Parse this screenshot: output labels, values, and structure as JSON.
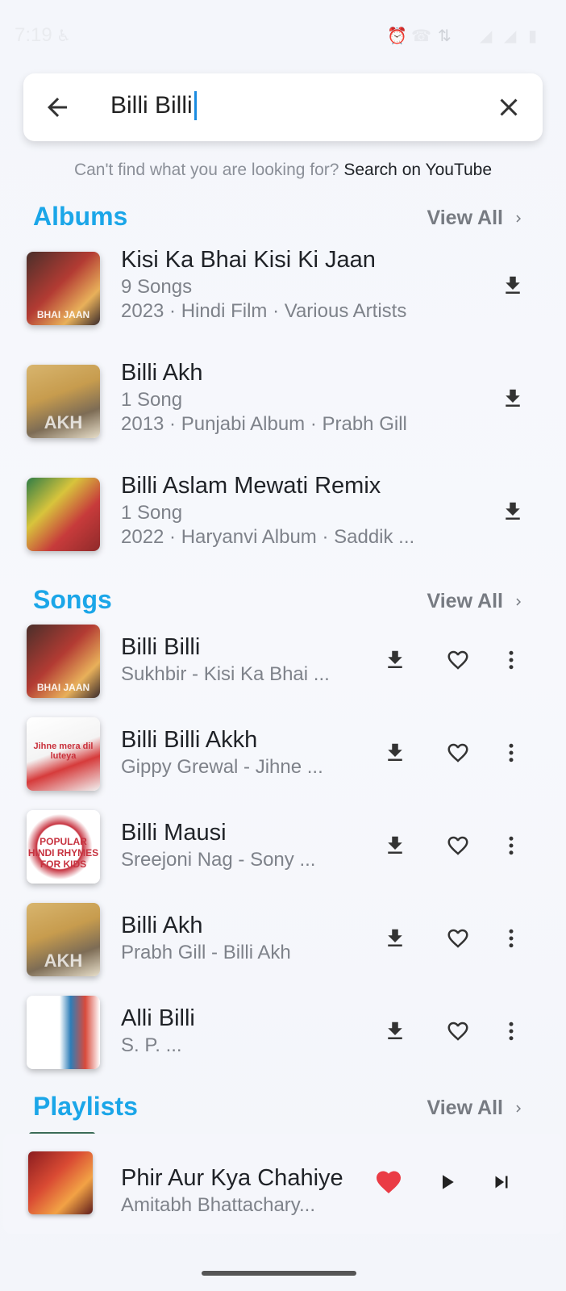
{
  "status_bar": {
    "time": "7:19"
  },
  "search": {
    "query": "Billi Billi"
  },
  "hint": {
    "text": "Can't find what you are looking for?",
    "link": "Search on YouTube"
  },
  "albums": {
    "title": "Albums",
    "view_all": "View All",
    "items": [
      {
        "title": "Kisi Ka Bhai Kisi Ki Jaan",
        "count": "9 Songs",
        "meta": "2023 · Hindi Film · Various Artists",
        "art_text": "BHAI JAAN"
      },
      {
        "title": "Billi Akh",
        "count": "1 Song",
        "meta": "2013 · Punjabi Album · Prabh Gill",
        "art_text": "AKH"
      },
      {
        "title": "Billi Aslam Mewati Remix",
        "count": "1 Song",
        "meta": "2022 · Haryanvi Album · Saddik ...",
        "art_text": ""
      }
    ]
  },
  "songs": {
    "title": "Songs",
    "view_all": "View All",
    "items": [
      {
        "title": "Billi Billi",
        "subtitle": "Sukhbir - Kisi Ka Bhai ...",
        "art_text": "BHAI JAAN"
      },
      {
        "title": "Billi Billi Akkh",
        "subtitle": "Gippy Grewal - Jihne ...",
        "art_text": "Jihne mera dil luteya"
      },
      {
        "title": "Billi Mausi",
        "subtitle": "Sreejoni Nag - Sony ...",
        "art_text": "POPULAR HINDI RHYMES FOR KIDS"
      },
      {
        "title": "Billi Akh",
        "subtitle": "Prabh Gill - Billi Akh",
        "art_text": "AKH"
      },
      {
        "title": "Alli Billi",
        "subtitle": "S. P. ...",
        "art_text": ""
      }
    ]
  },
  "playlists": {
    "title": "Playlists",
    "view_all": "View All"
  },
  "mini_player": {
    "title": "Phir Aur Kya Chahiye",
    "artist": "Amitabh Bhattachary...",
    "liked": true
  },
  "colors": {
    "accent": "#1ba6e8",
    "like": "#ea3b45"
  },
  "icons": [
    "back-arrow-icon",
    "close-icon",
    "chevron-right-icon",
    "download-icon",
    "heart-outline-icon",
    "more-vert-icon",
    "heart-filled-icon",
    "play-icon",
    "skip-next-icon"
  ]
}
